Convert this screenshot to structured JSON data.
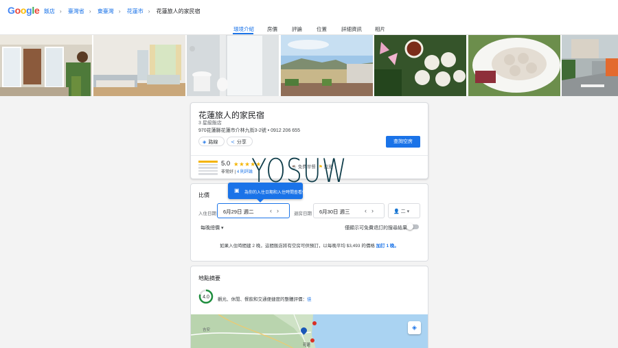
{
  "header": {
    "logo": "Google",
    "breadcrumbs": [
      "飯店",
      "臺灣省",
      "東臺灣",
      "花蓮市",
      "花蓮旅人的家民宿"
    ]
  },
  "tabs": [
    {
      "label": "環境介紹",
      "active": true
    },
    {
      "label": "房價",
      "active": false
    },
    {
      "label": "評論",
      "active": false
    },
    {
      "label": "位置",
      "active": false
    },
    {
      "label": "詳細資訊",
      "active": false
    },
    {
      "label": "相片",
      "active": false
    }
  ],
  "photos": [
    "entrance-photo",
    "bedroom-photo",
    "bathroom-photo",
    "terrace-view-photo",
    "dessert-photo",
    "dumpling-photo",
    "street-photo"
  ],
  "hotel": {
    "name": "花蓮旅人的家民宿",
    "class": "3 星級飯店",
    "address": "970花蓮縣花蓮市介林九街3-2號 • 0912 206 655",
    "route_label": "路線",
    "share_label": "分享",
    "check_availability_label": "查詢空房",
    "rating": "5.0",
    "stars": "★★★★★",
    "rating_word": "非常好",
    "reviews_link": "4 則評論",
    "amenities": [
      "免費早餐",
      "設施"
    ]
  },
  "pricing": {
    "title": "比價",
    "tooltip": "為你的入住日期和入住時間查看價格",
    "checkin_label": "入住日期",
    "checkin_value": "6月29日 週二",
    "checkout_label": "退房日期",
    "checkout_value": "6月30日 週三",
    "guests_value": "二",
    "per_night_label": "每晚總價 ▾",
    "toggle_label": "僅顯示可免費退訂的搜尋結果",
    "notice_text": "如果入住時間建 2 晚，這間飯店將有空房可供預訂，以每晚平均 $3,493 的價格",
    "notice_link": "加訂 1 晚。"
  },
  "location": {
    "title": "地點摘要",
    "score": "4.0",
    "description": "觀光、休閒、餐飲和交通便捷度的整體評價：",
    "description_link": "佳"
  },
  "map": {
    "label_1": "花蓮",
    "label_2": "吉安"
  },
  "watermark": "YOSUW",
  "colors": {
    "accent": "#1a73e8",
    "star": "#f4b400",
    "score_ring": "#1e8e3e"
  }
}
